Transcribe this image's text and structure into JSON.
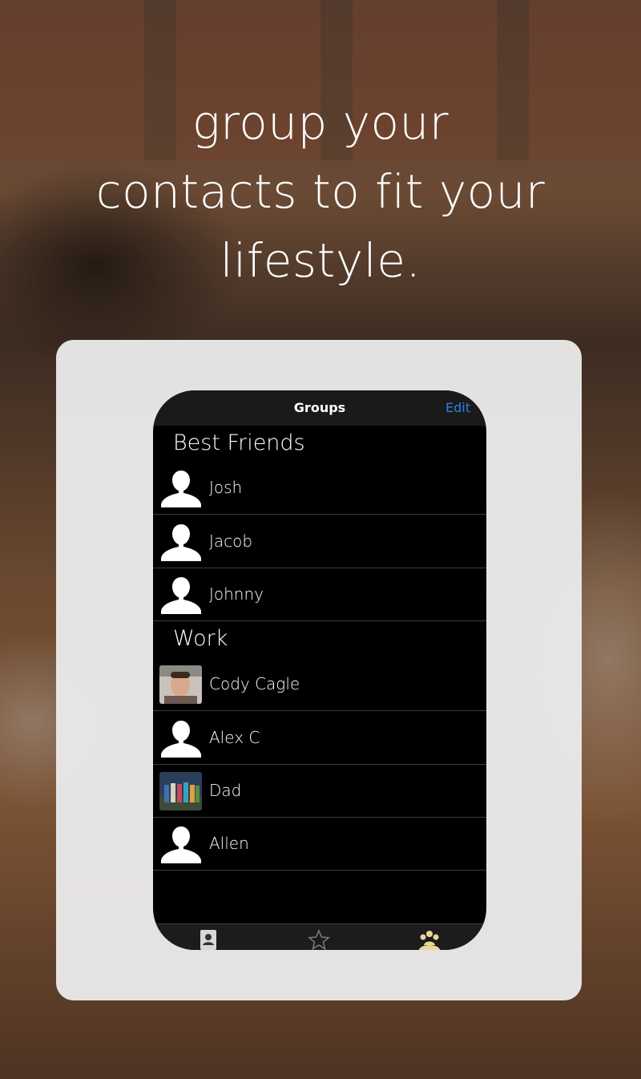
{
  "headline": {
    "line1": "group your",
    "line2": "contacts to fit your",
    "line3": "lifestyle."
  },
  "navbar": {
    "title": "Groups",
    "edit_label": "Edit"
  },
  "groups": [
    {
      "name": "Best Friends",
      "contacts": [
        {
          "name": "Josh",
          "avatar": "person-silhouette-icon"
        },
        {
          "name": "Jacob",
          "avatar": "person-silhouette-icon"
        },
        {
          "name": "Johnny",
          "avatar": "person-silhouette-icon"
        }
      ]
    },
    {
      "name": "Work",
      "contacts": [
        {
          "name": "Cody Cagle",
          "avatar": "photo"
        },
        {
          "name": "Alex C",
          "avatar": "person-silhouette-icon"
        },
        {
          "name": "Dad",
          "avatar": "photo"
        },
        {
          "name": "Allen",
          "avatar": "person-silhouette-icon"
        }
      ]
    }
  ],
  "tabbar": {
    "tabs": [
      "contacts-book-icon",
      "star-icon",
      "groups-icon"
    ],
    "active_tab": "groups-icon"
  },
  "colors": {
    "accent": "#2f7fe0",
    "active_tab": "#e8d79a"
  }
}
